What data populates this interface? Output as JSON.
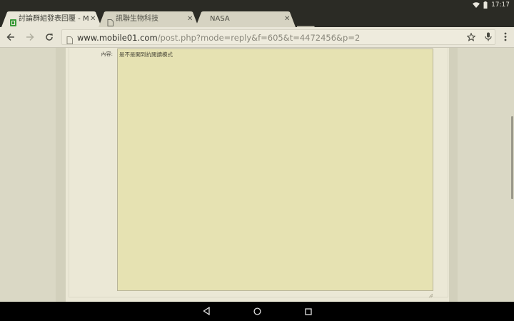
{
  "status_bar": {
    "time": "17:17"
  },
  "tabs": [
    {
      "title": "討論群組發表回覆 - M",
      "favicon": "mobile01-favicon",
      "active": true
    },
    {
      "title": "訊聯生物科技",
      "favicon": "page-icon",
      "active": false
    },
    {
      "title": "NASA",
      "favicon": "none",
      "active": false
    }
  ],
  "toolbar": {
    "url_host": "www.mobile01.com",
    "url_path": "/post.php?mode=reply&f=605&t=4472456&p=2"
  },
  "form": {
    "content_label": "內容:",
    "content_value": "是不是開到抗閱讀模式"
  },
  "icons": {
    "back": "back-arrow-icon",
    "forward": "forward-arrow-icon",
    "reload": "reload-icon",
    "star": "star-icon",
    "mic": "mic-icon",
    "menu": "overflow-menu-icon",
    "wifi": "wifi-icon",
    "battery": "battery-icon"
  },
  "colors": {
    "chrome_dark": "#2b2b25",
    "tab_active": "#e9e6d8",
    "textarea_bg": "#e6e2b2",
    "page_bg": "#ebe8d6",
    "brand_green": "#3a9a3a"
  }
}
